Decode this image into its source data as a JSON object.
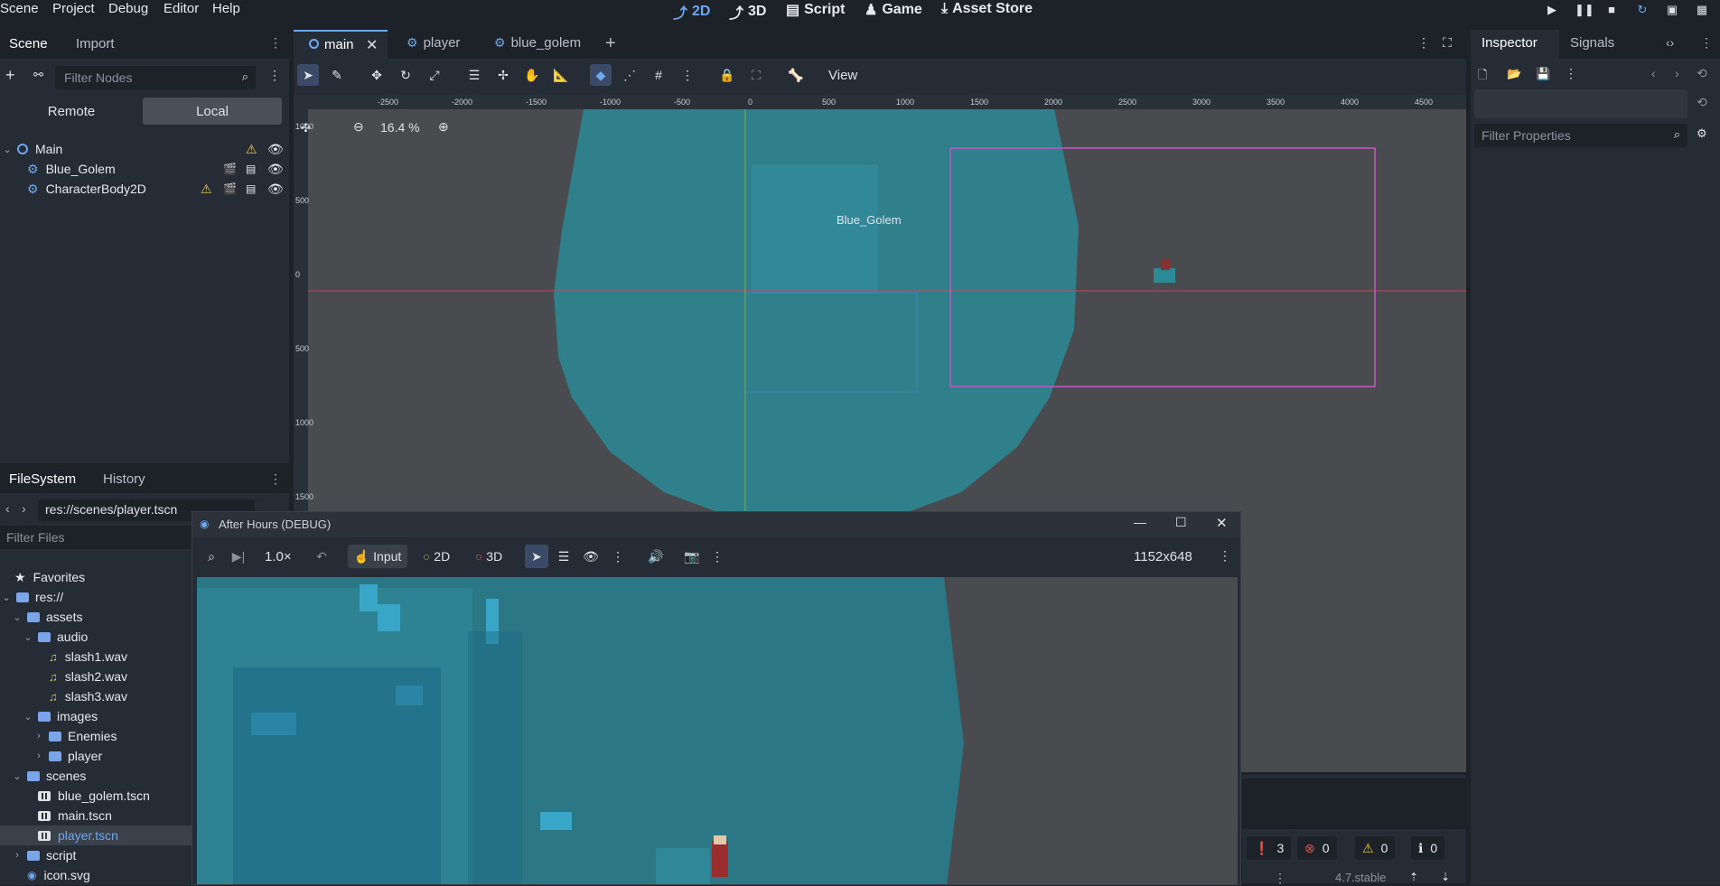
{
  "menu": [
    "Scene",
    "Project",
    "Debug",
    "Editor",
    "Help"
  ],
  "workspaces": {
    "w2d": "2D",
    "w3d": "3D",
    "script": "Script",
    "game": "Game",
    "asset": "Asset Store"
  },
  "scene_dock": {
    "tab_scene": "Scene",
    "tab_import": "Import",
    "filter_placeholder": "Filter Nodes",
    "remote": "Remote",
    "local": "Local",
    "nodes": [
      {
        "label": "Main"
      },
      {
        "label": "Blue_Golem"
      },
      {
        "label": "CharacterBody2D"
      }
    ]
  },
  "filesystem": {
    "tab_fs": "FileSystem",
    "tab_history": "History",
    "path": "res://scenes/player.tscn",
    "filter_placeholder": "Filter Files",
    "favorites": "Favorites",
    "root": "res://",
    "items": [
      "assets",
      "audio",
      "slash1.wav",
      "slash2.wav",
      "slash3.wav",
      "images",
      "Enemies",
      "player",
      "scenes",
      "blue_golem.tscn",
      "main.tscn",
      "player.tscn",
      "script",
      "icon.svg"
    ]
  },
  "scene_tabs": [
    "main",
    "player",
    "blue_golem"
  ],
  "viewport": {
    "view_label": "View",
    "zoom": "16.4 %",
    "node_label": "Blue_Golem",
    "ruler_x": [
      "-2500",
      "-2000",
      "-1500",
      "-1000",
      "-500",
      "0",
      "500",
      "1000",
      "1500",
      "2000",
      "2500",
      "3000",
      "3500",
      "4000",
      "4500"
    ],
    "ruler_y": [
      "1000",
      "500",
      "0",
      "500",
      "1000",
      "1500"
    ]
  },
  "inspector": {
    "tab_inspector": "Inspector",
    "tab_signals": "Signals",
    "filter_placeholder": "Filter Properties"
  },
  "game_window": {
    "title": "After Hours (DEBUG)",
    "speed": "1.0×",
    "input": "Input",
    "mode2d": "2D",
    "mode3d": "3D",
    "resolution": "1152x648"
  },
  "status": {
    "errors_total": "3",
    "errors": "0",
    "warnings": "0",
    "messages": "0",
    "version": "4.7.stable"
  },
  "colors": {
    "accent": "#6ea8f0",
    "panel": "#262c35",
    "viewport": "#4a4b4e",
    "cyan": "#2c8a97",
    "magenta": "#c656c6"
  }
}
